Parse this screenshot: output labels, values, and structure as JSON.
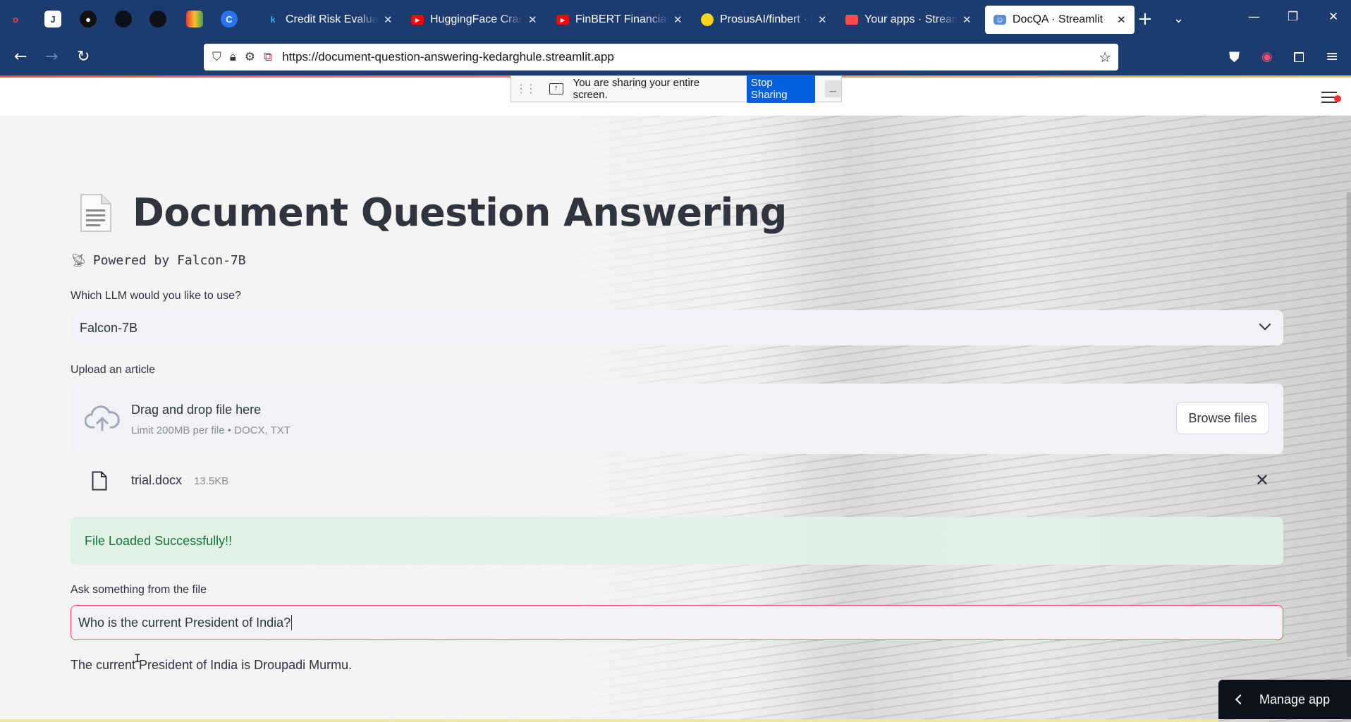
{
  "browser": {
    "tabs": [
      {
        "title": "Credit Risk Evaluation",
        "favicon": "kaggle-k-icon",
        "active": false
      },
      {
        "title": "HuggingFace Crash Course",
        "favicon": "youtube-icon",
        "active": false
      },
      {
        "title": "FinBERT Financial Sentiment",
        "favicon": "youtube-icon",
        "active": false
      },
      {
        "title": "ProsusAI/finbert · Hugging Face",
        "favicon": "huggingface-icon",
        "active": false
      },
      {
        "title": "Your apps · Streamlit",
        "favicon": "streamlit-icon",
        "active": false
      },
      {
        "title": "DocQA · Streamlit",
        "favicon": "robot-icon",
        "active": true
      }
    ],
    "url": "https://document-question-answering-kedarghule.streamlit.app"
  },
  "sharing": {
    "message": "You are sharing your entire screen.",
    "stop_label": "Stop Sharing",
    "hide_label": "_"
  },
  "app": {
    "title": "Document Question Answering",
    "subtitle": "Powered by Falcon-7B",
    "llm_label": "Which LLM would you like to use?",
    "llm_selected": "Falcon-7B",
    "upload_label": "Upload an article",
    "dropzone_main": "Drag and drop file here",
    "dropzone_sub": "Limit 200MB per file • DOCX, TXT",
    "browse_label": "Browse files",
    "file": {
      "name": "trial.docx",
      "size": "13.5KB"
    },
    "success_message": "File Loaded Successfully!!",
    "question_label": "Ask something from the file",
    "question_value": "Who is the current President of India?",
    "answer": "The current President of India is Droupadi Murmu.",
    "manage_label": "Manage app"
  },
  "colors": {
    "tabbar": "#1c3b6e",
    "accent_red": "#ff4b4b",
    "success_text": "#177233",
    "stop_sharing_blue": "#0060df"
  }
}
